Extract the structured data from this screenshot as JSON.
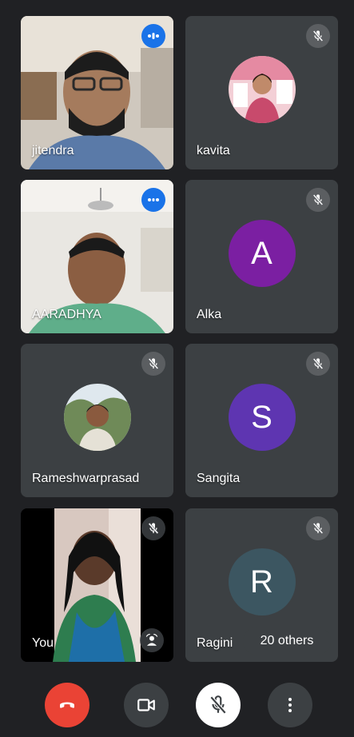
{
  "participants": [
    {
      "name": "jitendra",
      "state": "speaking",
      "mode": "video"
    },
    {
      "name": "kavita",
      "state": "muted",
      "mode": "photo"
    },
    {
      "name": "AARADHYA",
      "state": "speaking",
      "mode": "video"
    },
    {
      "name": "Alka",
      "state": "muted",
      "mode": "letter",
      "initial": "A",
      "color": "#7b1fa2"
    },
    {
      "name": "Rameshwarprasad",
      "state": "muted",
      "mode": "photo"
    },
    {
      "name": "Sangita",
      "state": "muted",
      "mode": "letter",
      "initial": "S",
      "color": "#5e35b1"
    },
    {
      "name": "You",
      "state": "muted",
      "mode": "video"
    },
    {
      "name": "Ragini",
      "state": "muted",
      "mode": "letter",
      "initial": "R",
      "color": "#3c5661"
    }
  ],
  "others_label": "20 others",
  "controls": {
    "end_call_color": "#ea4335",
    "camera_bg": "#3c4043",
    "mic_bg": "#ffffff",
    "more_bg": "#3c4043"
  },
  "icons": {
    "mute": "mic-off-icon",
    "speaking": "audio-level-icon",
    "end_call": "phone-hangup-icon",
    "camera": "videocam-icon",
    "mic": "mic-off-icon",
    "more": "more-vert-icon",
    "you_tile": "self-view-effects-icon"
  }
}
